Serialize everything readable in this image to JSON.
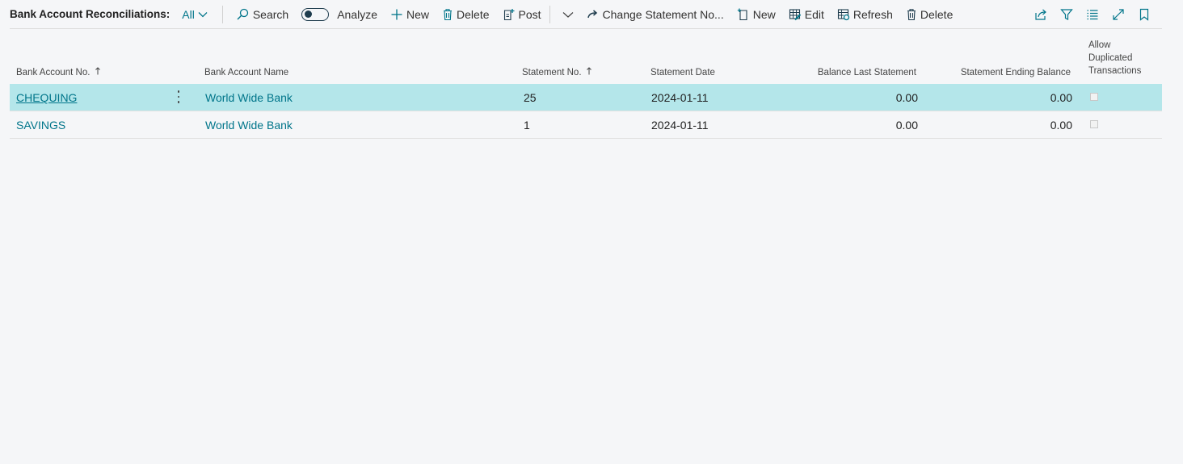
{
  "page_title": "Bank Account Reconciliations:",
  "view_filter": "All",
  "toolbar": {
    "search": "Search",
    "analyze": "Analyze",
    "new": "New",
    "delete": "Delete",
    "post": "Post",
    "change_statement": "Change Statement No...",
    "new2": "New",
    "edit": "Edit",
    "refresh": "Refresh",
    "delete2": "Delete"
  },
  "columns": {
    "bank_account_no": "Bank Account No.",
    "bank_account_name": "Bank Account Name",
    "statement_no": "Statement No.",
    "statement_date": "Statement Date",
    "balance_last": "Balance Last Statement",
    "ending_balance": "Statement Ending Balance",
    "allow_dup_1": "Allow",
    "allow_dup_2": "Duplicated",
    "allow_dup_3": "Transactions"
  },
  "rows": [
    {
      "account_no": "CHEQUING",
      "account_name": "World Wide Bank",
      "statement_no": "25",
      "statement_date": "2024-01-11",
      "balance_last": "0.00",
      "ending_balance": "0.00",
      "allow_duplicated": false,
      "selected": true
    },
    {
      "account_no": "SAVINGS",
      "account_name": "World Wide Bank",
      "statement_no": "1",
      "statement_date": "2024-01-11",
      "balance_last": "0.00",
      "ending_balance": "0.00",
      "allow_duplicated": false,
      "selected": false
    }
  ],
  "colors": {
    "accent": "#00758a",
    "selected_row": "#b4e6ea",
    "background": "#f5f6f8"
  }
}
